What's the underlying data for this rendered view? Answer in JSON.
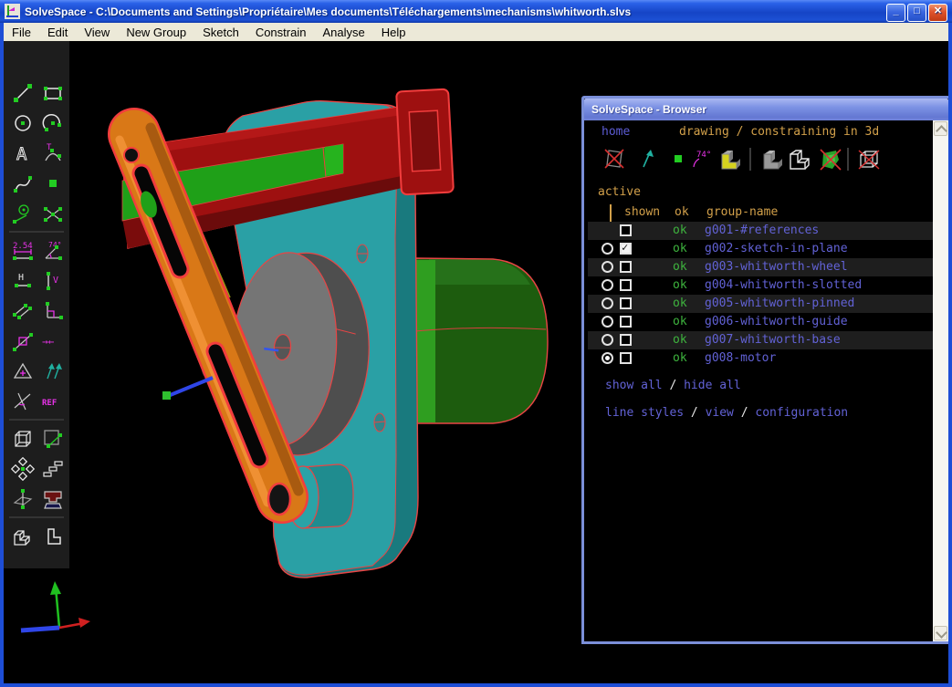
{
  "window": {
    "title": "SolveSpace - C:\\Documents and Settings\\Propriétaire\\Mes documents\\Téléchargements\\mechanisms\\whitworth.slvs",
    "controls": [
      "minimize",
      "maximize",
      "close"
    ]
  },
  "menu": {
    "items": [
      "File",
      "Edit",
      "View",
      "New Group",
      "Sketch",
      "Constrain",
      "Analyse",
      "Help"
    ]
  },
  "toolbar": {
    "tools": [
      {
        "name": "line-segment-tool"
      },
      {
        "name": "rectangle-tool"
      },
      {
        "name": "circle-tool"
      },
      {
        "name": "arc-tool"
      },
      {
        "name": "text-tool",
        "glyph": "A"
      },
      {
        "name": "tangent-arc-tool",
        "glyph": "T"
      },
      {
        "name": "bezier-spline-tool"
      },
      {
        "name": "datum-point-tool"
      },
      {
        "name": "construction-circle-tool"
      },
      {
        "name": "split-entities-tool"
      },
      {
        "name": "distance-constraint-tool",
        "glyph": "2.54"
      },
      {
        "name": "angle-constraint-tool",
        "glyph": "74°"
      },
      {
        "name": "horizontal-constraint-tool",
        "glyph": "H"
      },
      {
        "name": "vertical-constraint-tool",
        "glyph": "V"
      },
      {
        "name": "parallel-constraint-tool"
      },
      {
        "name": "perpendicular-constraint-tool"
      },
      {
        "name": "on-entity-constraint-tool"
      },
      {
        "name": "symmetric-constraint-tool",
        "glyph": "→←"
      },
      {
        "name": "equal-constraint-tool"
      },
      {
        "name": "parallel-normals-constraint-tool"
      },
      {
        "name": "other-angle-constraint-tool"
      },
      {
        "name": "reference-dimension-tool",
        "glyph": "REF"
      },
      {
        "name": "extrude-group-tool"
      },
      {
        "name": "translate-group-tool"
      },
      {
        "name": "step-rotate-group-tool"
      },
      {
        "name": "step-translate-group-tool"
      },
      {
        "name": "sketch-in-plane-tool"
      },
      {
        "name": "boolean-difference-tool"
      },
      {
        "name": "union-solid-tool"
      },
      {
        "name": "flat-part-tool"
      }
    ]
  },
  "browser": {
    "title": "SolveSpace - Browser",
    "nav": {
      "home": "home",
      "path": "drawing / constraining in 3d"
    },
    "toolbar_icons": [
      {
        "name": "no-workplane-icon"
      },
      {
        "name": "normal-arrow-icon"
      },
      {
        "name": "point-icon"
      },
      {
        "name": "angle-icon",
        "glyph": "74°"
      },
      {
        "name": "solid-model-shaded-icon"
      },
      {
        "name": "solid-model-gray-icon"
      },
      {
        "name": "solid-model-shell-icon"
      },
      {
        "name": "mesh-hidden-icon"
      },
      {
        "name": "wireframe-hidden-icon"
      }
    ],
    "section_label": "active",
    "columns": {
      "shown": "shown",
      "ok": "ok",
      "group_name": "group-name"
    },
    "groups": [
      {
        "name": "g001-#references",
        "ok": "ok",
        "shown": false,
        "active": false
      },
      {
        "name": "g002-sketch-in-plane",
        "ok": "ok",
        "shown": true,
        "active": false
      },
      {
        "name": "g003-whitworth-wheel",
        "ok": "ok",
        "shown": false,
        "active": false
      },
      {
        "name": "g004-whitworth-slotted",
        "ok": "ok",
        "shown": false,
        "active": false
      },
      {
        "name": "g005-whitworth-pinned",
        "ok": "ok",
        "shown": false,
        "active": false
      },
      {
        "name": "g006-whitworth-guide",
        "ok": "ok",
        "shown": false,
        "active": false
      },
      {
        "name": "g007-whitworth-base",
        "ok": "ok",
        "shown": false,
        "active": false
      },
      {
        "name": "g008-motor",
        "ok": "ok",
        "shown": false,
        "active": true
      }
    ],
    "links": {
      "show_all": "show all",
      "hide_all": "hide all",
      "sep": "/",
      "line_styles": "line styles",
      "view": "view",
      "configuration": "configuration"
    }
  },
  "colors": {
    "base_plate_teal": "#2aa0a5",
    "plate_side_teal": "#197a7e",
    "slotted_bar_red": "#9e1010",
    "edge_red": "#f23d3d",
    "slot_green": "#1fa018",
    "rocker_arm_orange": "#d97817",
    "wheel_gray": "#757575",
    "motor_green": "#1d5c0e",
    "axis_x_red": "#d02020",
    "axis_y_green": "#20c020",
    "axis_z_blue": "#2f46e8",
    "browser_accent_orange": "#d2a04a",
    "browser_link_blue": "#6262d6",
    "ok_green": "#3eb43e"
  }
}
